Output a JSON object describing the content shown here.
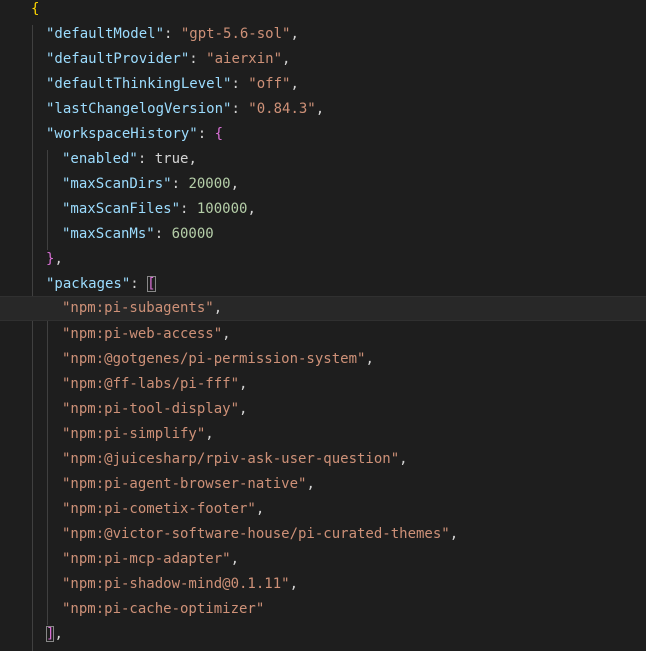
{
  "brace_open": "{",
  "settings": {
    "defaultModel": {
      "key": "\"defaultModel\"",
      "value": "\"gpt-5.6-sol\""
    },
    "defaultProvider": {
      "key": "\"defaultProvider\"",
      "value": "\"aierxin\""
    },
    "defaultThinkingLevel": {
      "key": "\"defaultThinkingLevel\"",
      "value": "\"off\""
    },
    "lastChangelogVersion": {
      "key": "\"lastChangelogVersion\"",
      "value": "\"0.84.3\""
    }
  },
  "workspaceHistory": {
    "key": "\"workspaceHistory\"",
    "open": "{",
    "close": "}",
    "enabled": {
      "key": "\"enabled\"",
      "value": "true"
    },
    "maxScanDirs": {
      "key": "\"maxScanDirs\"",
      "value": "20000"
    },
    "maxScanFiles": {
      "key": "\"maxScanFiles\"",
      "value": "100000"
    },
    "maxScanMs": {
      "key": "\"maxScanMs\"",
      "value": "60000"
    }
  },
  "packages": {
    "key": "\"packages\"",
    "open": "[",
    "close": "]",
    "items": [
      "\"npm:pi-subagents\"",
      "\"npm:pi-web-access\"",
      "\"npm:@gotgenes/pi-permission-system\"",
      "\"npm:@ff-labs/pi-fff\"",
      "\"npm:pi-tool-display\"",
      "\"npm:pi-simplify\"",
      "\"npm:@juicesharp/rpiv-ask-user-question\"",
      "\"npm:pi-agent-browser-native\"",
      "\"npm:pi-cometix-footer\"",
      "\"npm:@victor-software-house/pi-curated-themes\"",
      "\"npm:pi-mcp-adapter\"",
      "\"npm:pi-shadow-mind@0.1.11\"",
      "\"npm:pi-cache-optimizer\""
    ]
  },
  "colors": {
    "background": "#1e1e1e",
    "key": "#9cdcfe",
    "string": "#ce9178",
    "number": "#b5cea8",
    "bracket_level_1": "#ffd700",
    "bracket_level_2": "#da70d6",
    "bracket_level_3": "#179fff"
  }
}
